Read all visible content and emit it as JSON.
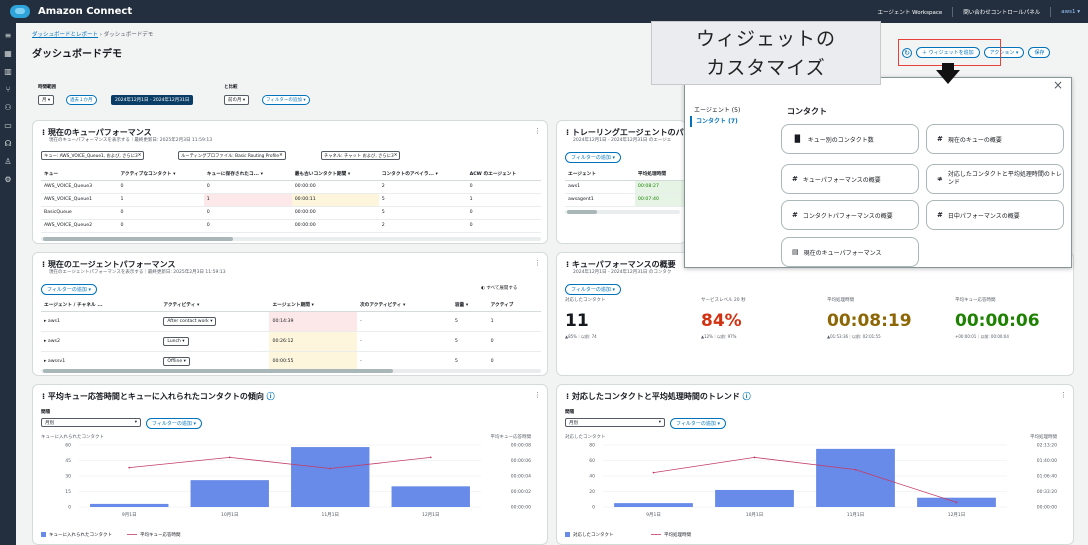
{
  "topbar": {
    "brand": "Amazon Connect",
    "links": [
      "エージェント Workspace",
      "問い合わせコントロールパネル",
      "aws1 ▾"
    ]
  },
  "sidebar_icons": [
    "menu-icon",
    "grid-icon",
    "chart-icon",
    "routing-icon",
    "users-icon",
    "channels-icon",
    "headset-icon",
    "user-icon",
    "settings-icon"
  ],
  "breadcrumb": {
    "parent": "ダッシュボードとレポート",
    "current": "ダッシュボードデモ"
  },
  "page_title": "ダッシュボードデモ",
  "header_actions": {
    "add_widget": "＋ ウィジェットを追加",
    "actions": "アクション ▾",
    "save": "保存"
  },
  "filters": {
    "period_label": "時間範囲",
    "period_value": "月 ▾",
    "prev_month": "過去１か月",
    "date_range": "2024年12月1日 - 2024年12月31日",
    "compare_label": "と比較",
    "compare_value": "前の月 ▾",
    "add_filter": "フィルターの追加 ▾"
  },
  "queue_perf": {
    "title": "現在のキューパフォーマンス",
    "subtitle": "現在のキューパフォーマンスを表示する｜最終更新日: 2025年2月3日 11:59:13",
    "tags": [
      "キュー: AWS_VOICE_Queue1, および, さらに3",
      "ルーティングプロファイル: Basic Routing Profile",
      "チャネル: チャット および, さらに3"
    ],
    "headers": [
      "キュー",
      "アクティブなコンタクト ▾",
      "キューに保存されたコ... ▾",
      "最も古いコンタクト期間 ▾",
      "コンタクトのアベイラ... ▾",
      "ACW のエージェント"
    ],
    "rows": [
      [
        "AWS_VOICE_Queue3",
        "0",
        "0",
        "00:00:00",
        "2",
        "0"
      ],
      [
        "AWS_VOICE_Queue1",
        "1",
        "1",
        "00:00:11",
        "5",
        "1"
      ],
      [
        "BasicQueue",
        "0",
        "0",
        "00:00:00",
        "5",
        "0"
      ],
      [
        "AWS_VOICE_Queue2",
        "0",
        "0",
        "00:00:00",
        "2",
        "0"
      ]
    ]
  },
  "trailing_agent": {
    "title": "トレーリングエージェントのパフ",
    "subtitle": "2024年12月1日 - 2024年12月31日 のエージェ",
    "add_filter": "フィルターの追加 ▾",
    "headers": [
      "エージェント",
      "平均処理時間"
    ],
    "rows": [
      [
        "aws1",
        "00:08:27"
      ],
      [
        "awsagent1",
        "00:07:40"
      ]
    ]
  },
  "agent_perf": {
    "title": "現在のエージェントパフォーマンス",
    "subtitle": "現在のエージェントパフォーマンスを表示する｜最終更新日: 2025年2月3日 11:59:13",
    "add_filter": "フィルターの追加 ▾",
    "expand_all": "すべて展開する",
    "headers": [
      "エージェント / チャネル ...",
      "アクティビティ ▾",
      "エージェント期間 ▾",
      "次のアクティビティ ▾",
      "容量 ▾",
      "アクティブ"
    ],
    "rows": [
      [
        "aws1",
        "After contact work ▾",
        "00:14:39",
        "-",
        "5",
        "1"
      ],
      [
        "aws2",
        "Lunch ▾",
        "00:26:12",
        "-",
        "5",
        "0"
      ],
      [
        "awssv1",
        "Offline ▾",
        "00:00:55",
        "-",
        "5",
        "0"
      ]
    ]
  },
  "queue_summary": {
    "title": "キューパフォーマンスの概要",
    "subtitle": "2024年12月1日 - 2024年12月31日 のコンタク",
    "add_filter": "フィルターの追加 ▾",
    "kpis": [
      {
        "label": "対応したコンタクト",
        "value": "11",
        "sub": "▲85%｜以前: 74",
        "color": "#16191f"
      },
      {
        "label": "サービスレベル 20 秒",
        "value": "84%",
        "sub": "▲12%｜以前: 97%",
        "color": "#d13212"
      },
      {
        "label": "平均処理時間",
        "value": "00:08:19",
        "sub": "▲01:53:36｜以前: 02:01:55",
        "color": "#8d6605"
      },
      {
        "label": "平均キュー応答時間",
        "value": "00:00:06",
        "sub": "+00:00:01｜以前: 00:00:04",
        "color": "#1d8102"
      }
    ]
  },
  "chart_left": {
    "title": "平均キュー応答時間とキューに入れられたコンタクトの傾向",
    "interval_label": "間隔",
    "interval_value": "月別",
    "add_filter": "フィルターの追加 ▾",
    "y_left_label": "キューに入れられたコンタクト",
    "y_right_label": "平均キュー応答時間",
    "legend": [
      "キューに入れられたコンタクト",
      "平均キュー応答時間"
    ],
    "y_ticks": [
      "60",
      "45",
      "30",
      "15",
      "0"
    ],
    "y2_ticks": [
      "00:00:08",
      "00:00:06",
      "00:00:04",
      "00:00:02",
      "00:00:00"
    ]
  },
  "chart_right": {
    "title": "対応したコンタクトと平均処理時間のトレンド",
    "interval_label": "間隔",
    "interval_value": "月別",
    "add_filter": "フィルターの追加 ▾",
    "y_left_label": "対応したコンタクト",
    "y_right_label": "平均処理時間",
    "legend": [
      "対応したコンタクト",
      "平均処理時間"
    ],
    "y_ticks": [
      "80",
      "60",
      "40",
      "20",
      "0"
    ],
    "y2_ticks": [
      "02:13:20",
      "01:40:00",
      "01:06:40",
      "00:33:20",
      "00:00:00"
    ]
  },
  "chart_data": [
    {
      "type": "bar",
      "title": "平均キュー応答時間とキューに入れられたコンタクトの傾向",
      "categories": [
        "9月1日",
        "10月1日",
        "11月1日",
        "12月1日"
      ],
      "series": [
        {
          "name": "キューに入れられたコンタクト",
          "values": [
            3,
            26,
            58,
            20
          ]
        },
        {
          "name": "平均キュー応答時間",
          "values": [
            4.6e-05,
            5.8e-05,
            4.5e-05,
            5.8e-05
          ]
        }
      ],
      "ylabel": "キューに入れられたコンタクト",
      "ylim": [
        0,
        60
      ]
    },
    {
      "type": "bar",
      "title": "対応したコンタクトと平均処理時間のトレンド",
      "categories": [
        "9月1日",
        "10月1日",
        "11月1日",
        "12月1日"
      ],
      "series": [
        {
          "name": "対応したコンタクト",
          "values": [
            5,
            22,
            75,
            12
          ]
        },
        {
          "name": "平均処理時間",
          "values": [
            0.9,
            1.3,
            0.98,
            0.12
          ]
        }
      ],
      "ylabel": "対応したコンタクト",
      "ylim": [
        0,
        80
      ]
    }
  ],
  "callout": {
    "line1": "ウィジェットの",
    "line2": "カスタマイズ"
  },
  "widget_popup": {
    "nav": [
      "エージェント (5)",
      "コンタクト (7)"
    ],
    "heading": "コンタクト",
    "widgets": [
      "キュー別のコンタクト数",
      "現在のキューの概要",
      "キューパフォーマンスの概要",
      "対応したコンタクトと平均処理時間のトレンド",
      "コンタクトパフォーマンスの概要",
      "日中パフォーマンスの概要",
      "現在のキューパフォーマンス"
    ],
    "icons": [
      "▐▌",
      "#",
      "#",
      "≉",
      "#",
      "#",
      "▤"
    ]
  },
  "colors": {
    "bar": "#688ae8",
    "line": "#c33d69",
    "accent": "#0073bb",
    "nav_bg": "#232f3e"
  }
}
